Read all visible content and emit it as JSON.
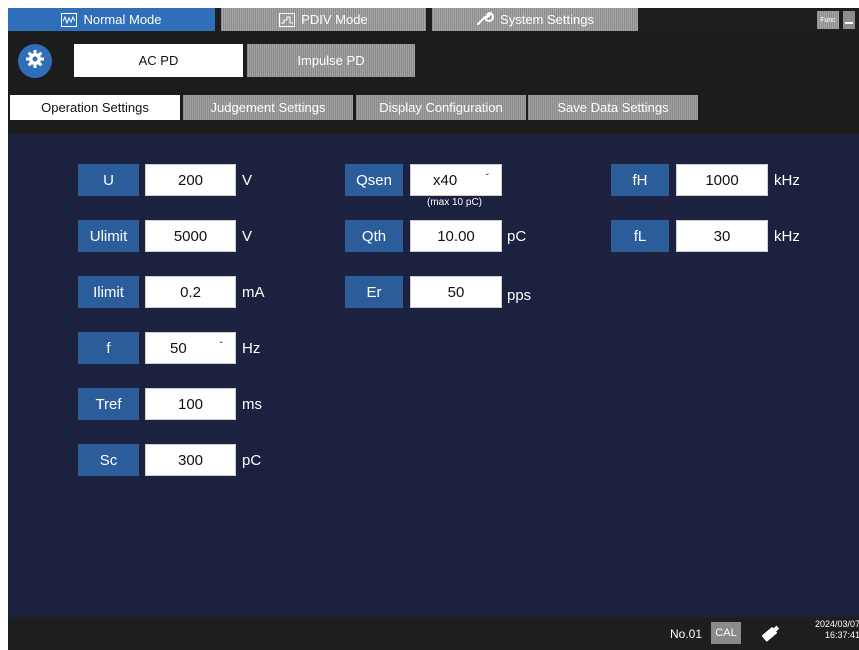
{
  "mode_tabs": [
    {
      "label": "Normal Mode",
      "icon": "waveform-icon",
      "active": true
    },
    {
      "label": "PDIV Mode",
      "icon": "step-wave-icon",
      "active": false
    },
    {
      "label": "System Settings",
      "icon": "wrench-icon",
      "active": false
    }
  ],
  "func_label": "Func",
  "pd_tabs": [
    {
      "label": "AC PD",
      "selected": true
    },
    {
      "label": "Impulse PD",
      "selected": false
    }
  ],
  "sub_tabs": [
    {
      "label": "Operation Settings",
      "selected": true
    },
    {
      "label": "Judgement Settings",
      "selected": false
    },
    {
      "label": "Display Configuration",
      "selected": false
    },
    {
      "label": "Save Data Settings",
      "selected": false
    }
  ],
  "params_col1": [
    {
      "name": "U",
      "value": "200",
      "unit": "V"
    },
    {
      "name": "Ulimit",
      "value": "5000",
      "unit": "V"
    },
    {
      "name": "Ilimit",
      "value": "0.2",
      "unit": "mA"
    },
    {
      "name": "f",
      "value": "50",
      "unit": "Hz",
      "dropdown": true
    },
    {
      "name": "Tref",
      "value": "100",
      "unit": "ms"
    },
    {
      "name": "Sc",
      "value": "300",
      "unit": "pC"
    }
  ],
  "params_col2": [
    {
      "name": "Qsen",
      "value": "x40",
      "unit": "",
      "dropdown": true,
      "note": "(max 10 pC)"
    },
    {
      "name": "Qth",
      "value": "10.00",
      "unit": "pC"
    },
    {
      "name": "Er",
      "value": "50",
      "unit": "pps"
    }
  ],
  "params_col3": [
    {
      "name": "fH",
      "value": "1000",
      "unit": "kHz"
    },
    {
      "name": "fL",
      "value": "30",
      "unit": "kHz"
    }
  ],
  "status": {
    "number": "No.01",
    "cal": "CAL",
    "date": "2024/03/07",
    "time": "16:37:41"
  },
  "colors": {
    "accent": "#2f6fba",
    "panel_bg": "#1c2140",
    "label_bg": "#2c5d9b"
  }
}
